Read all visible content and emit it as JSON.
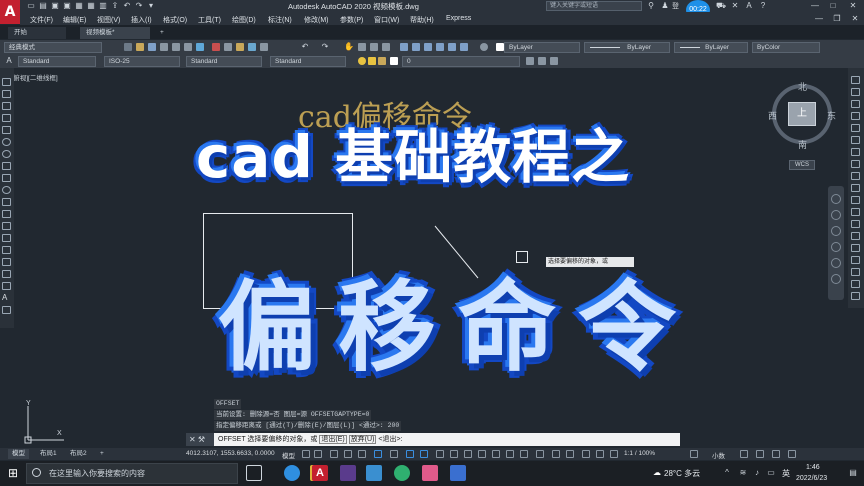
{
  "titlebar": {
    "app_letter": "A",
    "title": "Autodesk AutoCAD 2020    视频模板.dwg",
    "search_placeholder": "键入关键字或短语",
    "user": "登",
    "timer": "00:22",
    "window_buttons": [
      "—",
      "□",
      "✕"
    ]
  },
  "menu": [
    "文件(F)",
    "编辑(E)",
    "视图(V)",
    "插入(I)",
    "格式(O)",
    "工具(T)",
    "绘图(D)",
    "标注(N)",
    "修改(M)",
    "参数(P)",
    "窗口(W)",
    "帮助(H)",
    "Express"
  ],
  "file_tabs": {
    "start": "开始",
    "file": "视频模板*",
    "add": "+"
  },
  "toolbar1": {
    "workspace": "经典模式",
    "layer_color": "ByLayer",
    "linetype": "ByLayer",
    "lineweight": "ByLayer",
    "plotstyle": "ByColor"
  },
  "toolbar2": {
    "text_style": "Standard",
    "dim_style": "ISO-25",
    "table_style": "Standard",
    "mleader_style": "Standard",
    "layer": "0"
  },
  "view_label": "[−][俯视][二维线框]",
  "viewcube": {
    "north": "北",
    "south": "南",
    "east": "东",
    "west": "西",
    "top": "上",
    "wcs": "WCS"
  },
  "overlay": {
    "ghost": "cad偏移命令",
    "title": "cad 基础教程之",
    "subtitle": "偏移命令"
  },
  "tooltip": "选择要偏移的对象，或",
  "ucs": {
    "x": "X",
    "y": "Y"
  },
  "history": [
    "OFFSET",
    "当前设置: 删除源=否  图层=源  OFFSETGAPTYPE=0",
    "指定偏移距离或 [通过(T)/删除(E)/图层(L)] <通过>:  200"
  ],
  "command_line": {
    "prompt": "OFFSET 选择要偏移的对象，或",
    "option1": "退出(E)",
    "option2": "放弃(U)",
    "suffix": "<退出>:"
  },
  "layout_tabs": [
    "模型",
    "布局1",
    "布局2",
    "+"
  ],
  "status": {
    "coords": "4012.3107, 1553.6633, 0.0000",
    "model": "模型",
    "scale": "1:1 / 100%",
    "units": "小数"
  },
  "taskbar": {
    "search": "在这里输入你要搜索的内容",
    "weather": "28°C 多云",
    "ime": "英",
    "time": "1:46",
    "date": "2022/6/23"
  }
}
